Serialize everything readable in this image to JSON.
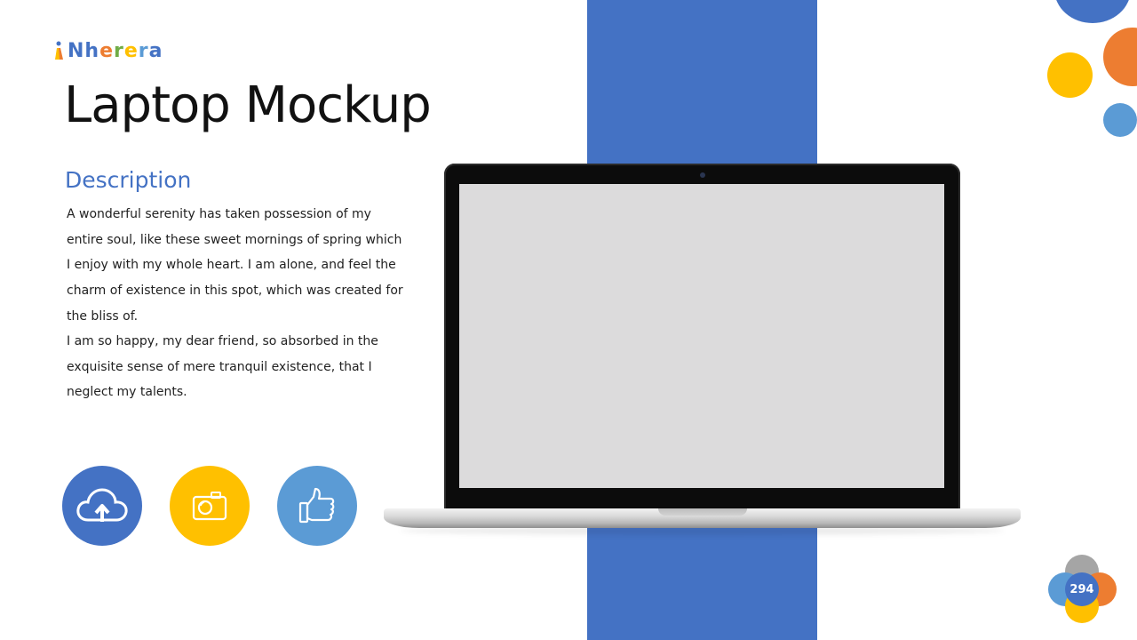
{
  "logo": {
    "text": "Nherera",
    "letters": [
      {
        "ch": "N",
        "color": "#4472C4"
      },
      {
        "ch": "h",
        "color": "#4472C4"
      },
      {
        "ch": "e",
        "color": "#ED7D31"
      },
      {
        "ch": "r",
        "color": "#70AD47"
      },
      {
        "ch": "e",
        "color": "#FFC000"
      },
      {
        "ch": "r",
        "color": "#5B9BD5"
      },
      {
        "ch": "a",
        "color": "#4472C4"
      }
    ]
  },
  "title": "Laptop Mockup",
  "section": {
    "heading": "Description",
    "paragraph_1": "A wonderful serenity has taken possession of my entire soul, like these sweet mornings of spring which I enjoy with my whole heart. I am alone, and feel the charm of existence in this spot, which was created for the bliss of.",
    "paragraph_2": "I am so happy, my dear friend, so absorbed in the exquisite sense of mere tranquil existence, that I neglect my talents."
  },
  "feature_icons": [
    {
      "icon": "cloud-upload-icon",
      "color": "#4472C4"
    },
    {
      "icon": "camera-icon",
      "color": "#FFC000"
    },
    {
      "icon": "thumbs-up-icon",
      "color": "#5B9BD5"
    }
  ],
  "colors": {
    "accent_blue": "#4472C4",
    "light_blue": "#5B9BD5",
    "orange": "#ED7D31",
    "yellow": "#FFC000",
    "gray": "#A5A5A5",
    "screen": "#DCDBDC"
  },
  "page_number": "294"
}
